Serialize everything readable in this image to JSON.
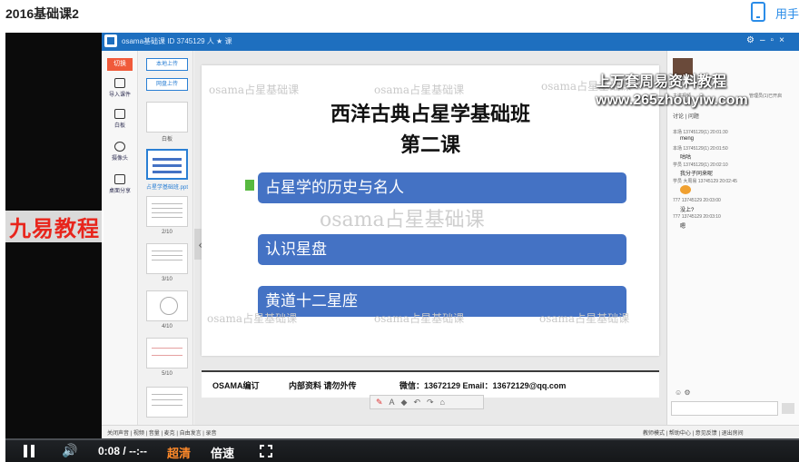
{
  "page": {
    "title": "2016基础课2",
    "phone_label": "用手"
  },
  "watermark": {
    "line1": "上万套周易资料教程",
    "line2": "www.265zhouyiw.com",
    "channel_logo": "九易教程"
  },
  "app": {
    "titlebar_text": "osama基础课 ID 3745129 人 ★ 课",
    "tools": [
      {
        "icon": "upload-icon",
        "label": "切换"
      },
      {
        "icon": "courseware-icon",
        "label": "导入课件"
      },
      {
        "icon": "edit-icon",
        "label": "白板"
      },
      {
        "icon": "camera-icon",
        "label": "摄像头"
      },
      {
        "icon": "screen-share-icon",
        "label": "桌面分享"
      }
    ],
    "thumb_buttons": [
      "本地上传",
      "网盘上传"
    ],
    "thumbs": [
      {
        "label": "白板"
      },
      {
        "label": "占星学基础班.ppt"
      },
      {
        "label": "2/10"
      },
      {
        "label": "3/10"
      },
      {
        "label": "4/10"
      },
      {
        "label": "5/10"
      }
    ],
    "status_left": "关闭声音 | 视频 | 音量 | 麦克 | 自由发言 | 录音",
    "status_right": "教师模式 | 帮助中心 | 意见反馈 | 退出房间"
  },
  "slide": {
    "title_line1": "西洋古典占星学基础班",
    "title_line2": "第二课",
    "watermark_text": "osama占星基础课",
    "items": [
      "占星学的历史与名人",
      "认识星盘",
      "黄道十二星座"
    ],
    "footer": {
      "left": "OSAMA编订",
      "middle": "内部资料 请勿外传",
      "right": "微信：13672129  Email：13672129@qq.com"
    }
  },
  "chat": {
    "header_left": "主讲视频",
    "header_right": "管理员(1)已开启",
    "tabs": "讨论  | 问题",
    "messages": [
      {
        "meta": "本场 13745129(1) 20:01:30",
        "text": "meng"
      },
      {
        "meta": "本场 13745129(1) 20:01:50",
        "text": "咕咕"
      },
      {
        "meta": "学员 13745129(1) 20:02:10",
        "text": "我分子同来呢"
      },
      {
        "meta": "学员 大周易 13745129 20:02:45",
        "text": ""
      },
      {
        "meta": "777 13745129 20:03:00",
        "text": "没上?"
      },
      {
        "meta": "777 13745129 20:03:10",
        "text": "嗯"
      }
    ]
  },
  "player": {
    "time_current": "0:08",
    "time_sep": "/",
    "time_total": "--:--",
    "quality": "超清",
    "speed": "倍速"
  }
}
